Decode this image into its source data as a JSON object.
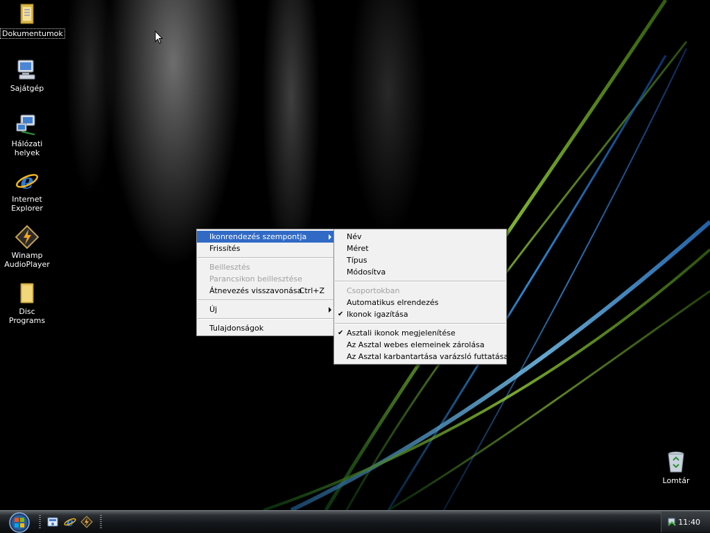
{
  "desktop": {
    "icons": [
      {
        "label": "Dokumentumok",
        "icon": "my-documents-folder-icon"
      },
      {
        "label": "Sajátgép",
        "icon": "my-computer-icon"
      },
      {
        "label": "Hálózati helyek",
        "icon": "network-places-icon"
      },
      {
        "label": "Internet Explorer",
        "icon": "internet-explorer-icon"
      },
      {
        "label": "Winamp AudioPlayer",
        "icon": "winamp-icon"
      },
      {
        "label": "Disc Programs",
        "icon": "folder-icon"
      },
      {
        "label": "Lomtár",
        "icon": "recycle-bin-icon"
      }
    ]
  },
  "context_menu": {
    "items": [
      {
        "label": "Ikonrendezés szempontja",
        "state": "highlighted",
        "submenu": true
      },
      {
        "label": "Frissítés"
      },
      {
        "label": "Beillesztés",
        "state": "disabled"
      },
      {
        "label": "Parancsikon beillesztése",
        "state": "disabled"
      },
      {
        "label": "Átnevezés visszavonása",
        "shortcut": "Ctrl+Z"
      },
      {
        "label": "Új",
        "submenu": true
      },
      {
        "label": "Tulajdonságok"
      }
    ]
  },
  "submenu": {
    "items": [
      {
        "label": "Név"
      },
      {
        "label": "Méret"
      },
      {
        "label": "Típus"
      },
      {
        "label": "Módosítva"
      },
      {
        "label": "Csoportokban",
        "state": "disabled"
      },
      {
        "label": "Automatikus elrendezés"
      },
      {
        "label": "Ikonok igazítása",
        "checked": true
      },
      {
        "label": "Asztali ikonok megjelenítése",
        "checked": true
      },
      {
        "label": "Az Asztal webes elemeinek zárolása"
      },
      {
        "label": "Az Asztal karbantartása varázsló futtatása"
      }
    ]
  },
  "taskbar": {
    "quick_launch": [
      "show-desktop-icon",
      "internet-explorer-icon",
      "winamp-icon"
    ],
    "clock": "11:40"
  },
  "colors": {
    "menu_highlight": "#316ac5",
    "menu_background": "#f1f1f1",
    "disabled_text": "#a0a0a0"
  }
}
